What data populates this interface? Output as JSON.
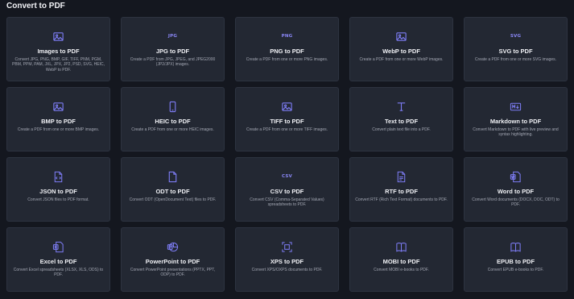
{
  "page": {
    "title": "Convert to PDF"
  },
  "cards": [
    {
      "title": "Images to PDF",
      "desc": "Convert JPG, PNG, BMP, GIF, TIFF, PNM, PGM, PBM, PPM, PAM, JXL, JPX, JP2, PSD, SVG, HEIC, WebP to PDF.",
      "icon": "image-icon",
      "iconText": ""
    },
    {
      "title": "JPG to PDF",
      "desc": "Create a PDF from JPG, JPEG, and JPEG2000 (JP2/JPX) images.",
      "icon": "jpg-icon",
      "iconText": "JPG"
    },
    {
      "title": "PNG to PDF",
      "desc": "Create a PDF from one or more PNG images.",
      "icon": "png-icon",
      "iconText": "PNG"
    },
    {
      "title": "WebP to PDF",
      "desc": "Create a PDF from one or more WebP images.",
      "icon": "webp-image-icon",
      "iconText": ""
    },
    {
      "title": "SVG to PDF",
      "desc": "Create a PDF from one or more SVG images.",
      "icon": "svg-icon",
      "iconText": "SVG"
    },
    {
      "title": "BMP to PDF",
      "desc": "Create a PDF from one or more BMP images.",
      "icon": "image-icon",
      "iconText": ""
    },
    {
      "title": "HEIC to PDF",
      "desc": "Create a PDF from one or more HEIC images.",
      "icon": "phone-icon",
      "iconText": ""
    },
    {
      "title": "TIFF to PDF",
      "desc": "Create a PDF from one or more TIFF images.",
      "icon": "image-icon",
      "iconText": ""
    },
    {
      "title": "Text to PDF",
      "desc": "Convert plain text file into a PDF.",
      "icon": "text-icon",
      "iconText": ""
    },
    {
      "title": "Markdown to PDF",
      "desc": "Convert Markdown to PDF with live preview and syntax highlighting.",
      "icon": "markdown-icon",
      "iconText": ""
    },
    {
      "title": "JSON to PDF",
      "desc": "Convert JSON files to PDF format.",
      "icon": "code-file-icon",
      "iconText": ""
    },
    {
      "title": "ODT to PDF",
      "desc": "Convert ODT (OpenDocument Text) files to PDF.",
      "icon": "document-icon",
      "iconText": ""
    },
    {
      "title": "CSV to PDF",
      "desc": "Convert CSV (Comma-Separated Values) spreadsheets to PDF.",
      "icon": "csv-icon",
      "iconText": "CSV"
    },
    {
      "title": "RTF to PDF",
      "desc": "Convert RTF (Rich Text Format) documents to PDF.",
      "icon": "text-file-icon",
      "iconText": ""
    },
    {
      "title": "Word to PDF",
      "desc": "Convert Word documents (DOCX, DOC, ODT) to PDF.",
      "icon": "word-icon",
      "iconText": ""
    },
    {
      "title": "Excel to PDF",
      "desc": "Convert Excel spreadsheets (XLSX, XLS, ODS) to PDF.",
      "icon": "excel-icon",
      "iconText": ""
    },
    {
      "title": "PowerPoint to PDF",
      "desc": "Convert PowerPoint presentations (PPTX, PPT, ODP) to PDF.",
      "icon": "powerpoint-icon",
      "iconText": ""
    },
    {
      "title": "XPS to PDF",
      "desc": "Convert XPS/OXPS documents to PDF.",
      "icon": "xps-icon",
      "iconText": ""
    },
    {
      "title": "MOBI to PDF",
      "desc": "Convert MOBI e-books to PDF.",
      "icon": "book-icon",
      "iconText": ""
    },
    {
      "title": "EPUB to PDF",
      "desc": "Convert EPUB e-books to PDF.",
      "icon": "book-icon",
      "iconText": ""
    }
  ]
}
